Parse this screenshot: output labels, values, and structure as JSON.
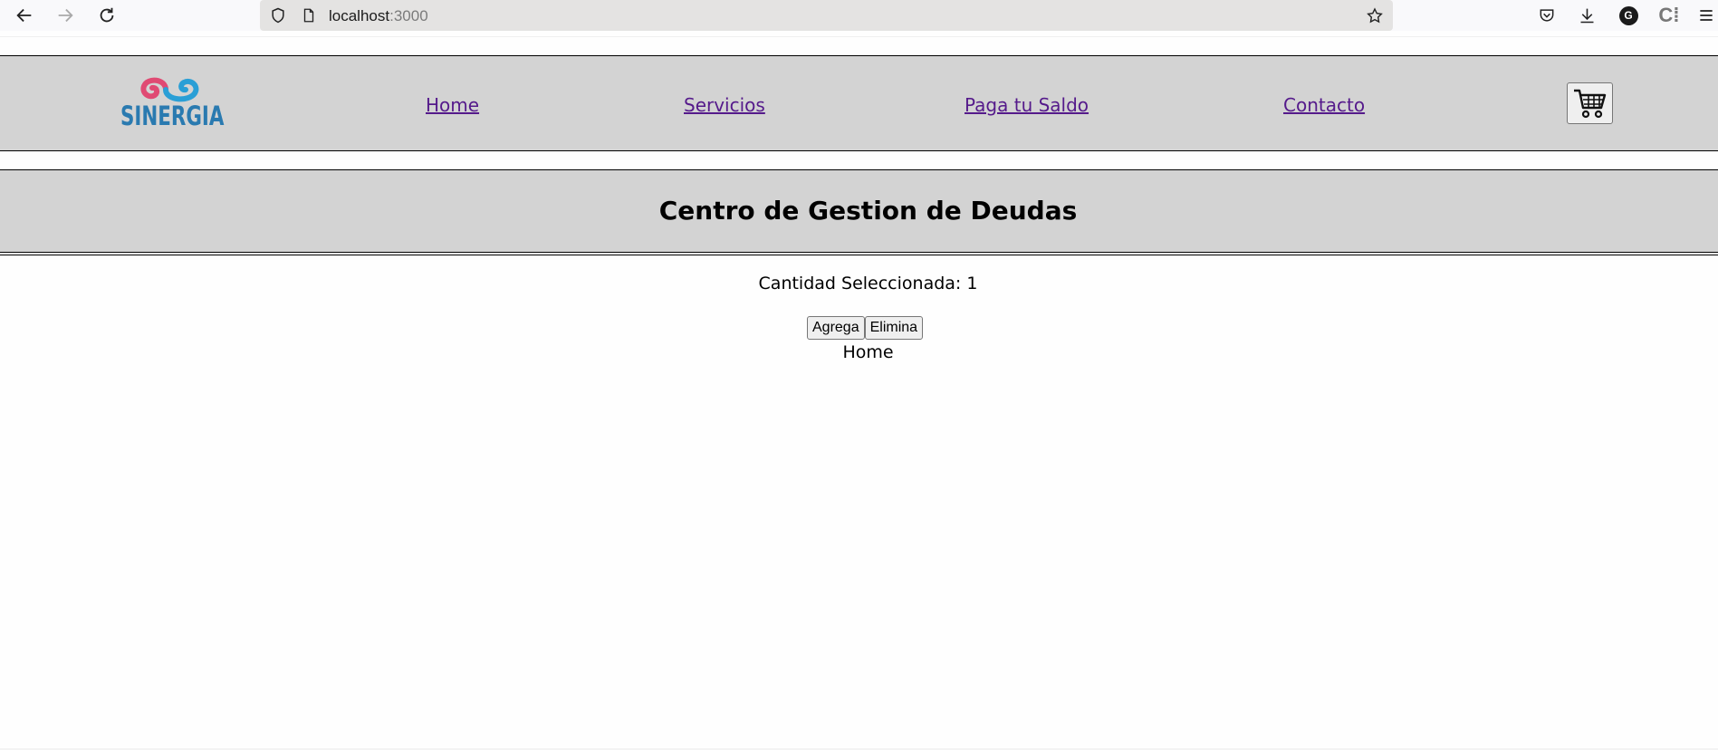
{
  "browser": {
    "url_host": "localhost",
    "url_port": ":3000",
    "icons": [
      "back-icon",
      "forward-icon",
      "reload-icon",
      "shield-icon",
      "page-icon",
      "star-icon",
      "pocket-icon",
      "download-icon",
      "account-icon",
      "extension-icon",
      "menu-icon"
    ],
    "account_initial": "G",
    "extension_label": "C⁞"
  },
  "nav": {
    "logo_text": "SINERGIA",
    "links": [
      "Home",
      "Servicios",
      "Paga tu Saldo",
      "Contacto"
    ],
    "cart_icon": "cart-icon"
  },
  "banner": {
    "title": "Centro de Gestion de Deudas"
  },
  "main": {
    "quantity_text": "Cantidad Seleccionada: 1",
    "add_label": "Agrega",
    "remove_label": "Elimina",
    "home_text": "Home"
  },
  "colors": {
    "link": "#551a8b",
    "nav_bg": "#d3d3d3",
    "logo_blue": "#2a7ab0",
    "logo_pink": "#e04a73"
  }
}
